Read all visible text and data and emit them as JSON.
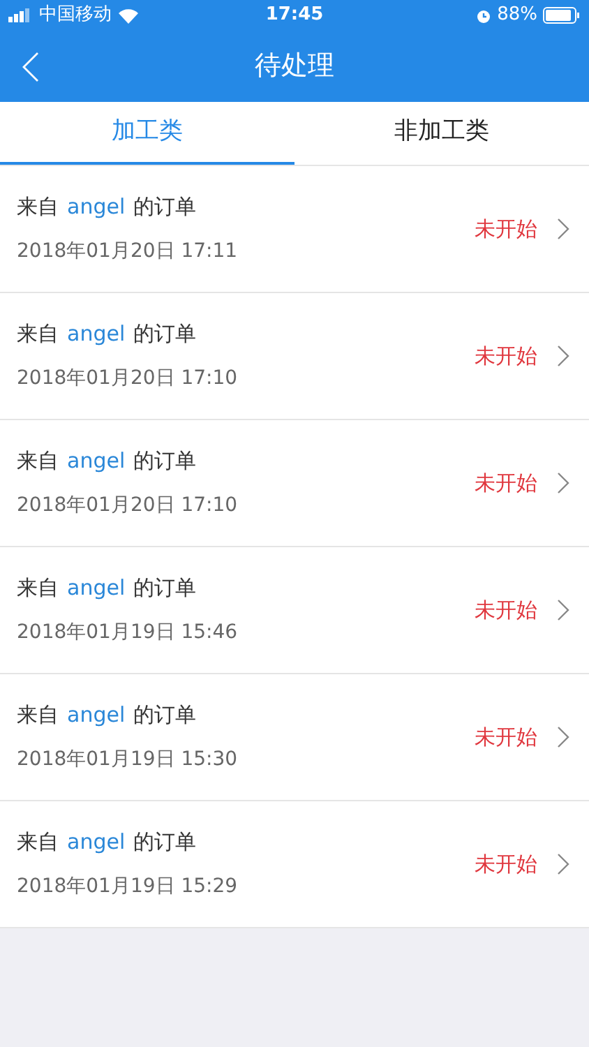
{
  "status_bar": {
    "carrier": "中国移动",
    "time": "17:45",
    "battery": "88%"
  },
  "nav": {
    "title": "待处理"
  },
  "tabs": [
    {
      "label": "加工类",
      "selected": true
    },
    {
      "label": "非加工类",
      "selected": false
    }
  ],
  "orders": [
    {
      "prefix": "来自",
      "sender": "angel",
      "suffix": "的订单",
      "date": "2018年01月20日 17:11",
      "status": "未开始"
    },
    {
      "prefix": "来自",
      "sender": "angel",
      "suffix": "的订单",
      "date": "2018年01月20日 17:10",
      "status": "未开始"
    },
    {
      "prefix": "来自",
      "sender": "angel",
      "suffix": "的订单",
      "date": "2018年01月20日 17:10",
      "status": "未开始"
    },
    {
      "prefix": "来自",
      "sender": "angel",
      "suffix": "的订单",
      "date": "2018年01月19日 15:46",
      "status": "未开始"
    },
    {
      "prefix": "来自",
      "sender": "angel",
      "suffix": "的订单",
      "date": "2018年01月19日 15:30",
      "status": "未开始"
    },
    {
      "prefix": "来自",
      "sender": "angel",
      "suffix": "的订单",
      "date": "2018年01月19日 15:29",
      "status": "未开始"
    }
  ]
}
